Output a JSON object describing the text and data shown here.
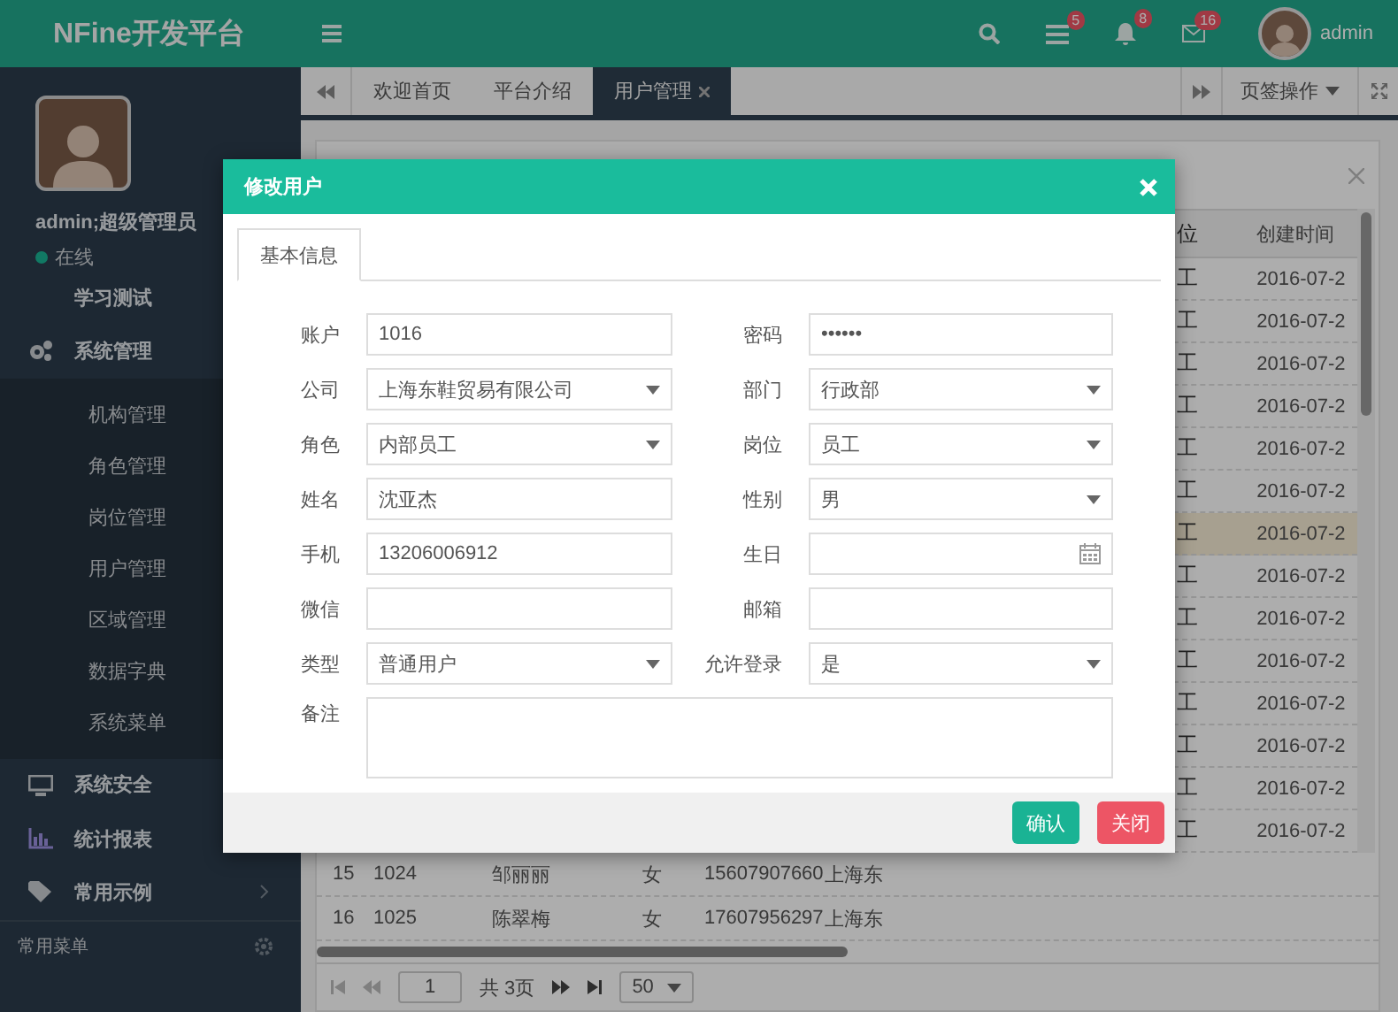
{
  "header": {
    "logo": "NFine开发平台",
    "badges": [
      {
        "count": "5"
      },
      {
        "count": "8"
      },
      {
        "count": "16"
      }
    ],
    "user": "admin"
  },
  "sidebar": {
    "user": "admin;超级管理员",
    "status": "在线",
    "items": [
      {
        "label": "学习测试"
      },
      {
        "label": "系统管理",
        "children": [
          {
            "label": "机构管理"
          },
          {
            "label": "角色管理"
          },
          {
            "label": "岗位管理"
          },
          {
            "label": "用户管理"
          },
          {
            "label": "区域管理"
          },
          {
            "label": "数据字典"
          },
          {
            "label": "系统菜单"
          }
        ]
      },
      {
        "label": "系统安全"
      },
      {
        "label": "统计报表"
      },
      {
        "label": "常用示例"
      }
    ],
    "section": "常用菜单"
  },
  "tabs": [
    {
      "label": "欢迎首页",
      "selected": false
    },
    {
      "label": "平台介绍",
      "selected": false
    },
    {
      "label": "用户管理",
      "selected": true
    }
  ],
  "tab_actions": "页签操作",
  "table": {
    "columns": [
      "位",
      "创建时间"
    ],
    "rows": [
      {
        "position": "工",
        "created": "2016-07-2",
        "selected": false
      },
      {
        "position": "工",
        "created": "2016-07-2",
        "selected": false
      },
      {
        "position": "工",
        "created": "2016-07-2",
        "selected": false
      },
      {
        "position": "工",
        "created": "2016-07-2",
        "selected": false
      },
      {
        "position": "工",
        "created": "2016-07-2",
        "selected": false
      },
      {
        "position": "工",
        "created": "2016-07-2",
        "selected": false
      },
      {
        "position": "工",
        "created": "2016-07-2",
        "selected": true
      },
      {
        "position": "工",
        "created": "2016-07-2",
        "selected": false
      },
      {
        "position": "工",
        "created": "2016-07-2",
        "selected": false
      },
      {
        "position": "工",
        "created": "2016-07-2",
        "selected": false
      },
      {
        "position": "工",
        "created": "2016-07-2",
        "selected": false
      },
      {
        "position": "工",
        "created": "2016-07-2",
        "selected": false
      },
      {
        "position": "工",
        "created": "2016-07-2",
        "selected": false
      },
      {
        "position": "工",
        "created": "2016-07-2",
        "selected": false
      }
    ],
    "lower_rows": [
      {
        "cells": [
          "15",
          "1024",
          "邹丽丽",
          "女",
          "15607907660",
          "上海东"
        ]
      },
      {
        "cells": [
          "16",
          "1025",
          "陈翠梅",
          "女",
          "17607956297",
          "上海东"
        ]
      }
    ]
  },
  "pager": {
    "page": "1",
    "total": "共 3页",
    "page_size": "50"
  },
  "modal": {
    "title": "修改用户",
    "tabs": [
      {
        "label": "基本信息",
        "selected": true
      }
    ],
    "fields": [
      {
        "label": "账户",
        "kind": "text",
        "value": "1016"
      },
      {
        "label": "密码",
        "kind": "text",
        "value": "••••••"
      },
      {
        "label": "公司",
        "kind": "select",
        "value": "上海东鞋贸易有限公司"
      },
      {
        "label": "部门",
        "kind": "select",
        "value": "行政部"
      },
      {
        "label": "角色",
        "kind": "select",
        "value": "内部员工"
      },
      {
        "label": "岗位",
        "kind": "select",
        "value": "员工"
      },
      {
        "label": "姓名",
        "kind": "text",
        "value": "沈亚杰"
      },
      {
        "label": "性别",
        "kind": "select",
        "value": "男"
      },
      {
        "label": "手机",
        "kind": "text",
        "value": "13206006912"
      },
      {
        "label": "生日",
        "kind": "date"
      },
      {
        "label": "微信",
        "kind": "text"
      },
      {
        "label": "邮箱",
        "kind": "text"
      },
      {
        "label": "类型",
        "kind": "select",
        "value": "普通用户"
      },
      {
        "label": "允许登录",
        "kind": "select",
        "value": "是"
      },
      {
        "label": "备注",
        "kind": "textarea"
      }
    ],
    "buttons": [
      {
        "label": "确认",
        "kind": "primary"
      },
      {
        "label": "关闭",
        "kind": "danger"
      }
    ]
  }
}
